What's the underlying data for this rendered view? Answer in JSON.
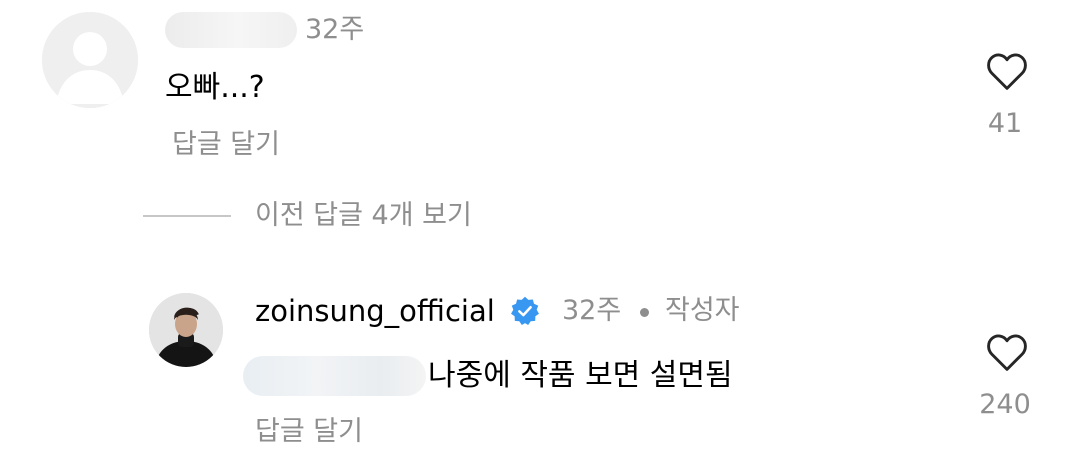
{
  "comments": [
    {
      "username": "",
      "time": "32주",
      "text": "오빠...?",
      "reply_label": "답글 달기",
      "like_count": "41"
    },
    {
      "username": "zoinsung_official",
      "time": "32주",
      "author_label": "작성자",
      "text": "나중에 작품 보면 설면됨",
      "reply_label": "답글 달기",
      "like_count": "240"
    }
  ],
  "view_previous_replies": "이전 답글 4개 보기",
  "icons": {
    "like": "heart-outline-icon",
    "verified": "verified-badge-icon",
    "default_avatar": "default-avatar-icon"
  },
  "colors": {
    "secondary_text": "#8e8e8e",
    "verified_blue": "#3897f0",
    "divider": "#c7c7c7"
  }
}
